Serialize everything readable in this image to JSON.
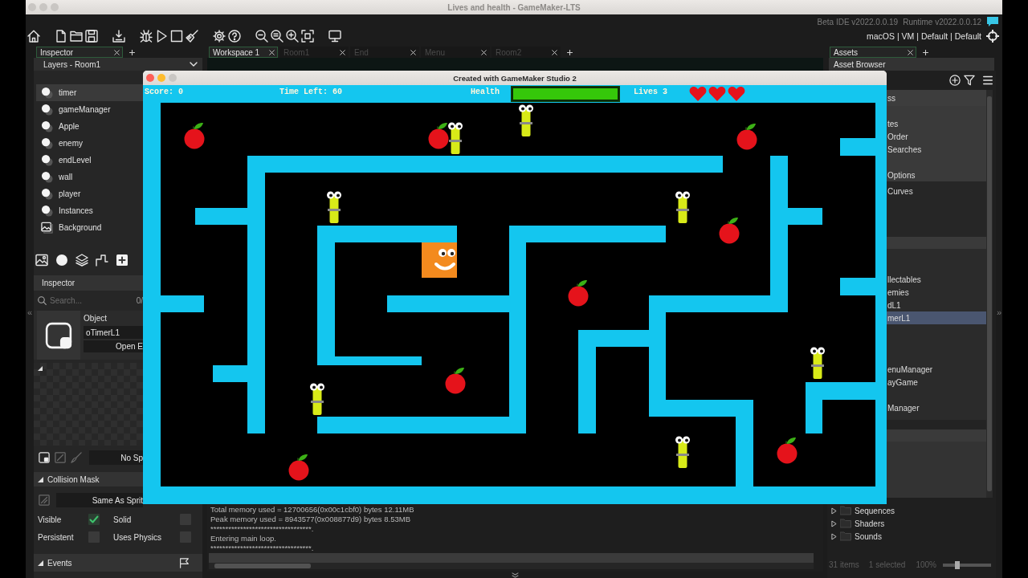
{
  "window": {
    "title": "Lives and health - GameMaker-LTS"
  },
  "toolbar": {
    "version_ide": "Beta IDE v2022.0.0.19",
    "version_runtime": "Runtime v2022.0.0.12",
    "target": "macOS | VM | Default | Default"
  },
  "side_toggles": {
    "left": "«",
    "right": "»"
  },
  "left_tabs": [
    {
      "label": "Inspector",
      "selected": true
    }
  ],
  "workspace_tabs": [
    {
      "label": "Workspace 1",
      "selected": true
    },
    {
      "label": "Room1",
      "selected": false
    },
    {
      "label": "End",
      "selected": false
    },
    {
      "label": "Menu",
      "selected": false
    },
    {
      "label": "Room2",
      "selected": false
    }
  ],
  "right_tabs": [
    {
      "label": "Assets",
      "selected": true
    }
  ],
  "layers_dropdown": {
    "value": "Layers - Room1"
  },
  "layers": [
    {
      "name": "timer",
      "kind": "instance",
      "selected": true
    },
    {
      "name": "gameManager",
      "kind": "instance",
      "selected": false
    },
    {
      "name": "Apple",
      "kind": "instance",
      "selected": false
    },
    {
      "name": "enemy",
      "kind": "instance",
      "selected": false
    },
    {
      "name": "endLevel",
      "kind": "instance",
      "selected": false
    },
    {
      "name": "wall",
      "kind": "instance",
      "selected": false
    },
    {
      "name": "player",
      "kind": "instance",
      "selected": false
    },
    {
      "name": "Instances",
      "kind": "instance",
      "selected": false
    },
    {
      "name": "Background",
      "kind": "background",
      "selected": false
    }
  ],
  "inspector": {
    "title": "Inspector",
    "search": {
      "placeholder": "Search..."
    },
    "count": "0/",
    "object_label": "Object",
    "object_name": "oTimerL1",
    "open_button": "Open E",
    "sprite_field": "No Sp",
    "collision_section": "Collision Mask",
    "mask_field": "Same As Sprit",
    "flags": [
      {
        "label": "Visible",
        "checked": true
      },
      {
        "label": "Solid",
        "checked": false
      },
      {
        "label": "Persistent",
        "checked": false
      },
      {
        "label": "Uses Physics",
        "checked": false
      }
    ],
    "events_section": "Events"
  },
  "console": {
    "lines": [
      "Total memory used = 12700656(0x00c1cbf0) bytes 12.11MB",
      "Peak memory used = 8943577(0x008877d9) bytes 8.53MB",
      "**********************************.",
      "Entering main loop.",
      "**********************************."
    ]
  },
  "asset_browser": {
    "title": "Asset Browser",
    "sections": [
      {
        "kind": "header",
        "groups": [
          {
            "items": [
              {
                "label": "ss",
                "selected": false
              }
            ]
          }
        ]
      },
      {
        "kind": "light",
        "groups": [
          {
            "items": [
              {
                "label": "tes",
                "selected": false
              },
              {
                "label": "Order",
                "selected": false
              },
              {
                "label": "Searches",
                "selected": false
              }
            ]
          },
          {
            "items": [
              {
                "label": "Options",
                "selected": false
              }
            ]
          }
        ]
      },
      {
        "kind": "dark",
        "groups": [
          {
            "items": [
              {
                "label": "Curves",
                "selected": false
              }
            ]
          }
        ]
      },
      {
        "kind": "mid",
        "groups": [
          {
            "items": [
              {
                "label": "llectables",
                "selected": false
              },
              {
                "label": "emies",
                "selected": false
              },
              {
                "label": "dL1",
                "selected": false
              },
              {
                "label": "merL1",
                "selected": true
              }
            ]
          },
          {
            "items": [
              {
                "label": "enuManager",
                "selected": false
              },
              {
                "label": "ayGame",
                "selected": false
              }
            ]
          },
          {
            "items": [
              {
                "label": "Manager",
                "selected": false
              }
            ]
          }
        ]
      }
    ],
    "folders": [
      {
        "label": "Sequences",
        "expanded": false
      },
      {
        "label": "Shaders",
        "expanded": false
      },
      {
        "label": "Sounds",
        "expanded": false
      }
    ],
    "status": {
      "items": "31 items",
      "selected": "1 selected",
      "zoom": "100%",
      "zoom_slider": {
        "level": 0.3
      }
    }
  },
  "game_window": {
    "title": "Created with GameMaker Studio 2",
    "hud": {
      "score": "Score: 0",
      "time_left": "Time Left: 60",
      "health_label": "Health",
      "health_bar": {
        "level": 1
      },
      "lives": "Lives 3",
      "hearts": {
        "stars": 3
      }
    }
  }
}
